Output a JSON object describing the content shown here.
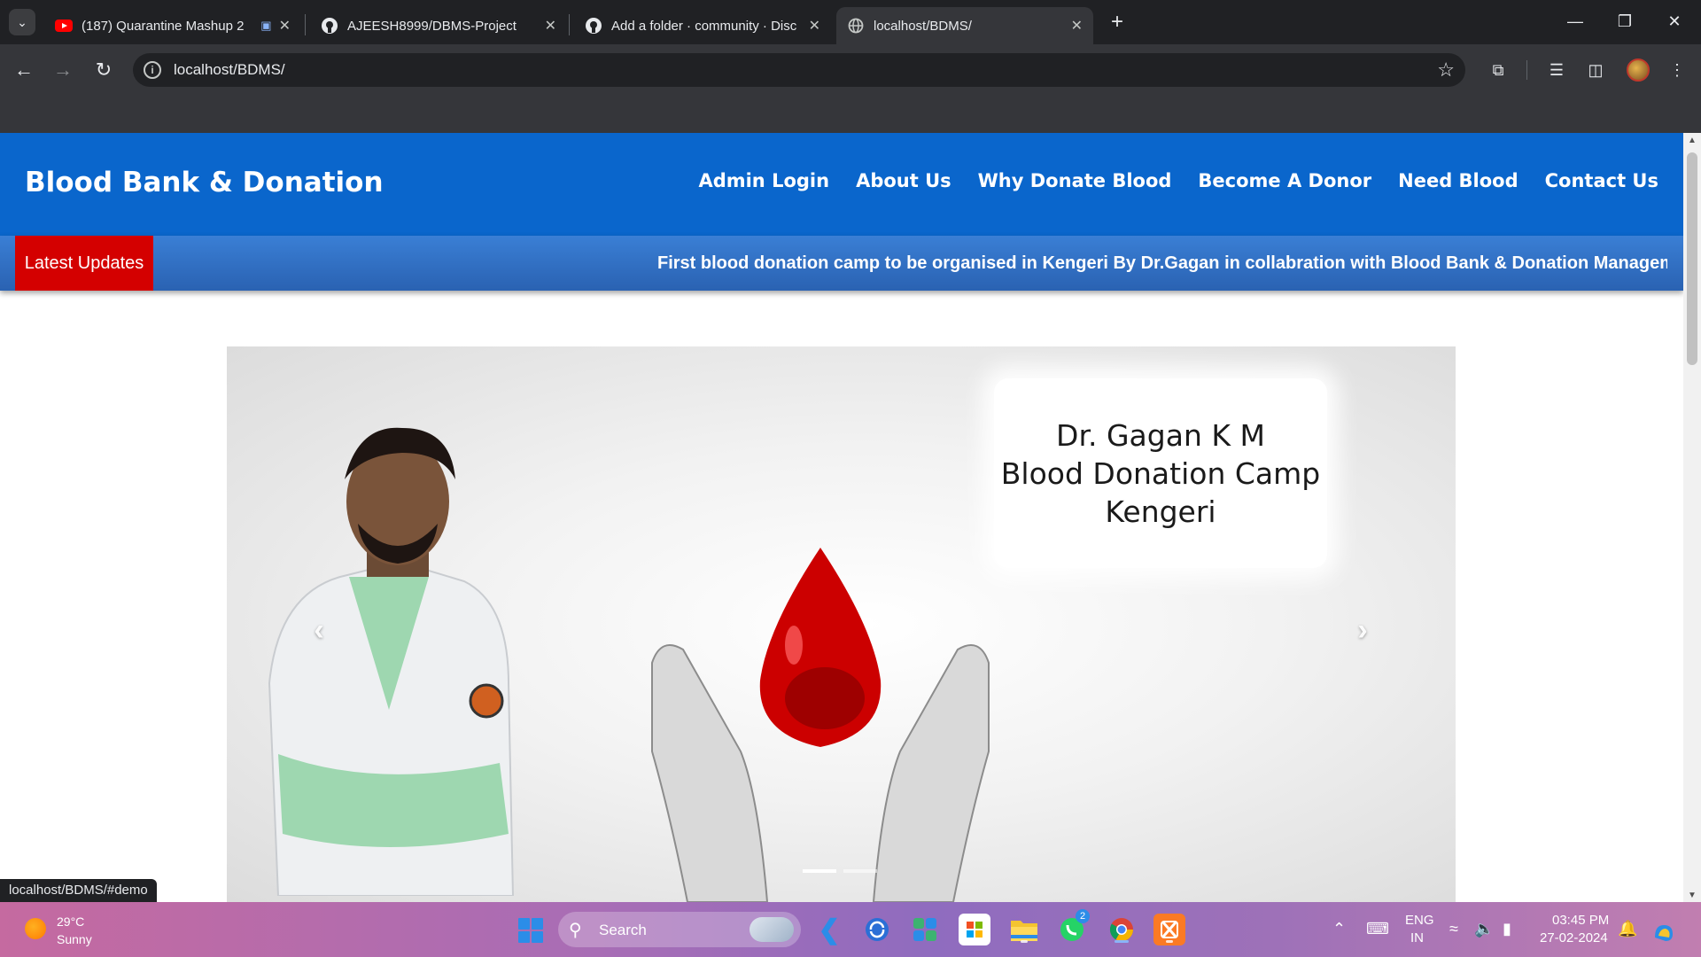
{
  "browser": {
    "tabs": [
      {
        "title": "(187) Quarantine Mashup 2",
        "favicon": "youtube-icon",
        "active": false
      },
      {
        "title": "AJEESH8999/DBMS-Project",
        "favicon": "github-icon",
        "active": false
      },
      {
        "title": "Add a folder · community · Disc",
        "favicon": "github-icon",
        "active": false
      },
      {
        "title": "localhost/BDMS/",
        "favicon": "globe-icon",
        "active": true
      }
    ],
    "address": "localhost/BDMS/",
    "status_url": "localhost/BDMS/#demo"
  },
  "site": {
    "brand": "Blood Bank & Donation",
    "nav": [
      "Admin Login",
      "About Us",
      "Why Donate Blood",
      "Become A Donor",
      "Need Blood",
      "Contact Us"
    ],
    "updates_label": "Latest Updates",
    "updates_text": "First blood donation camp to be organised in Kengeri By Dr.Gagan in collabration with Blood Bank & Donation Management Syst",
    "slide": {
      "lines": [
        "Dr. Gagan K M",
        "Blood Donation Camp",
        "Kengeri"
      ],
      "slide_count": 2,
      "active_index": 0
    },
    "colors": {
      "header": "#0a66cc",
      "updates_label_bg": "#d40000",
      "blood_drop": "#cc0000"
    }
  },
  "taskbar": {
    "weather_temp": "29°C",
    "weather_desc": "Sunny",
    "search_placeholder": "Search",
    "whatsapp_badge": "2",
    "lang_line1": "ENG",
    "lang_line2": "IN",
    "time": "03:45 PM",
    "date": "27-02-2024"
  }
}
